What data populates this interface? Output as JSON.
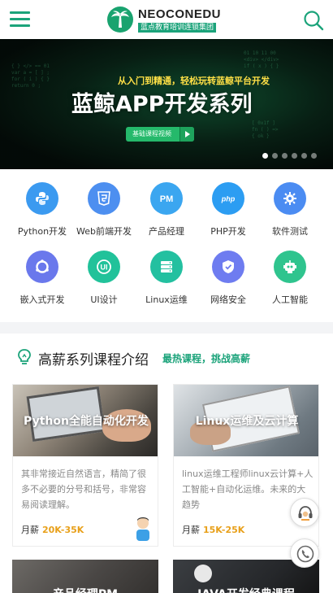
{
  "header": {
    "logo_name": "NEOCONEDU",
    "logo_sub": "蓝点教育培训连锁集团",
    "menu_icon": "hamburger-menu-icon",
    "search_icon": "search-icon",
    "brand_color": "#1ba37a"
  },
  "banner": {
    "slogan": "从入门到精通，轻松玩转蓝鲸平台开发",
    "title": "蓝鲸APP开发系列",
    "cta_label": "基础课程视频",
    "slide_count": 6,
    "active_slide": 1
  },
  "categories": [
    {
      "label": "Python开发",
      "icon": "python-icon",
      "color": "#3b9af0"
    },
    {
      "label": "Web前端开发",
      "icon": "html5-icon",
      "color": "#4d8ff0"
    },
    {
      "label": "产品经理",
      "icon": "pm-icon",
      "color": "#3ba6f0"
    },
    {
      "label": "PHP开发",
      "icon": "php-icon",
      "color": "#2c9df2"
    },
    {
      "label": "软件测试",
      "icon": "gear-bug-icon",
      "color": "#4b8cf2"
    },
    {
      "label": "嵌入式开发",
      "icon": "ring-chip-icon",
      "color": "#6a78ec"
    },
    {
      "label": "UI设计",
      "icon": "ui-icon",
      "color": "#21c29a"
    },
    {
      "label": "Linux运维",
      "icon": "server-icon",
      "color": "#23c0a0"
    },
    {
      "label": "网络安全",
      "icon": "shield-icon",
      "color": "#6e7cf0"
    },
    {
      "label": "人工智能",
      "icon": "robot-icon",
      "color": "#2fc48e"
    }
  ],
  "courses_section": {
    "title": "高薪系列课程介绍",
    "subtitle": "最热课程，挑战高薪",
    "cards": [
      {
        "title": "Python全能自动化开发",
        "desc": "其非常接近自然语言，精简了很多不必要的分号和括号，非常容易阅读理解。",
        "salary_label": "月薪",
        "salary": "20K-35K"
      },
      {
        "title": "Linux运维及云计算",
        "desc": "linux运维工程师linux云计算+人工智能+自动化运维。未来的大趋势",
        "salary_label": "月薪",
        "salary": "15K-25K"
      }
    ],
    "more_cards": [
      {
        "title": "产品经理PM"
      },
      {
        "title": "JAVA开发经典课程"
      }
    ]
  },
  "floating": {
    "service_icon": "customer-service-icon",
    "phone_icon": "phone-icon"
  }
}
